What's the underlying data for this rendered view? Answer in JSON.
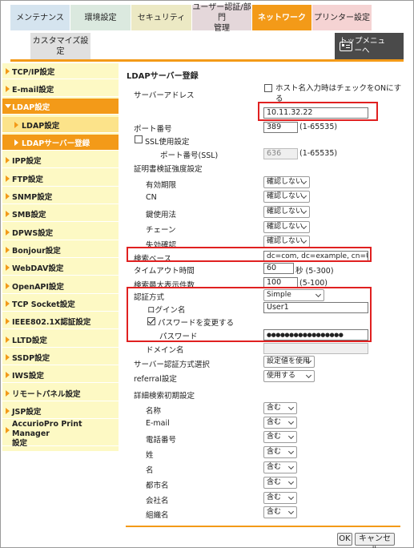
{
  "tabs": {
    "maintenance": "メンテナンス",
    "environment": "環境設定",
    "security": "セキュリティ",
    "user_auth_line1": "ユーザー認証/部門",
    "user_auth_line2": "管理",
    "network": "ネットワーク",
    "printer": "プリンター設定",
    "customize": "カスタマイズ設定",
    "top_menu_line1": "トップメニュ",
    "top_menu_line2": "ーへ"
  },
  "sidebar": {
    "items": [
      "TCP/IP設定",
      "E-mail設定",
      "LDAP設定",
      "LDAP設定",
      "LDAPサーバー登録",
      "IPP設定",
      "FTP設定",
      "SNMP設定",
      "SMB設定",
      "DPWS設定",
      "Bonjour設定",
      "WebDAV設定",
      "OpenAPI設定",
      "TCP Socket設定",
      "IEEE802.1X認証設定",
      "LLTD設定",
      "SSDP設定",
      "IWS設定",
      "リモートパネル設定",
      "JSP設定"
    ],
    "accurio_line1": "AccurioPro Print Manager",
    "accurio_line2": "設定"
  },
  "main": {
    "title": "LDAPサーバー登録",
    "server_address_label": "サーバーアドレス",
    "hostname_check_line1": "ホスト名入力時はチェックをONにす",
    "hostname_check_line2": "る",
    "server_address_value": "10.11.32.22",
    "port_label": "ポート番号",
    "port_value": "389",
    "port_range": "(1-65535)",
    "ssl_label": "SSL使用設定",
    "ssl_port_label": "ポート番号(SSL)",
    "ssl_port_value": "636",
    "ssl_port_range": "(1-65535)",
    "cert_label": "証明書検証強度設定",
    "cert_rows": [
      {
        "label": "有効期限",
        "value": "確認しない"
      },
      {
        "label": "CN",
        "value": "確認しない"
      },
      {
        "label": "鍵使用法",
        "value": "確認しない"
      },
      {
        "label": "チェーン",
        "value": "確認しない"
      },
      {
        "label": "失効確認",
        "value": "確認しない"
      }
    ],
    "search_base_label": "検索ベース",
    "search_base_value": "dc=com, dc=example, cn=Users",
    "timeout_label": "タイムアウト時間",
    "timeout_value": "60",
    "timeout_unit": "秒 (5-300)",
    "max_results_label": "検索最大表示件数",
    "max_results_value": "100",
    "max_results_range": "(5-100)",
    "auth_label": "認証方式",
    "auth_value": "Simple",
    "login_label": "ログイン名",
    "login_value": "User1",
    "change_pw_label": "パスワードを変更する",
    "password_label": "パスワード",
    "password_value": "●●●●●●●●●●●●●●●●●",
    "domain_label": "ドメイン名",
    "domain_value": "",
    "server_auth_label": "サーバー認証方式選択",
    "server_auth_value": "設定値を使用",
    "referral_label": "referral設定",
    "referral_value": "使用する",
    "advanced_label": "詳細検索初期設定",
    "advanced_rows": [
      {
        "label": "名称",
        "value": "含む"
      },
      {
        "label": "E-mail",
        "value": "含む"
      },
      {
        "label": "電話番号",
        "value": "含む"
      },
      {
        "label": "姓",
        "value": "含む"
      },
      {
        "label": "名",
        "value": "含む"
      },
      {
        "label": "都市名",
        "value": "含む"
      },
      {
        "label": "会社名",
        "value": "含む"
      },
      {
        "label": "組織名",
        "value": "含む"
      }
    ],
    "ok_label": "OK",
    "cancel_label": "キャンセル"
  },
  "colors": {
    "accent": "#f39a18",
    "sidebar_bg": "#fdf9c4",
    "highlight": "#e02020"
  }
}
